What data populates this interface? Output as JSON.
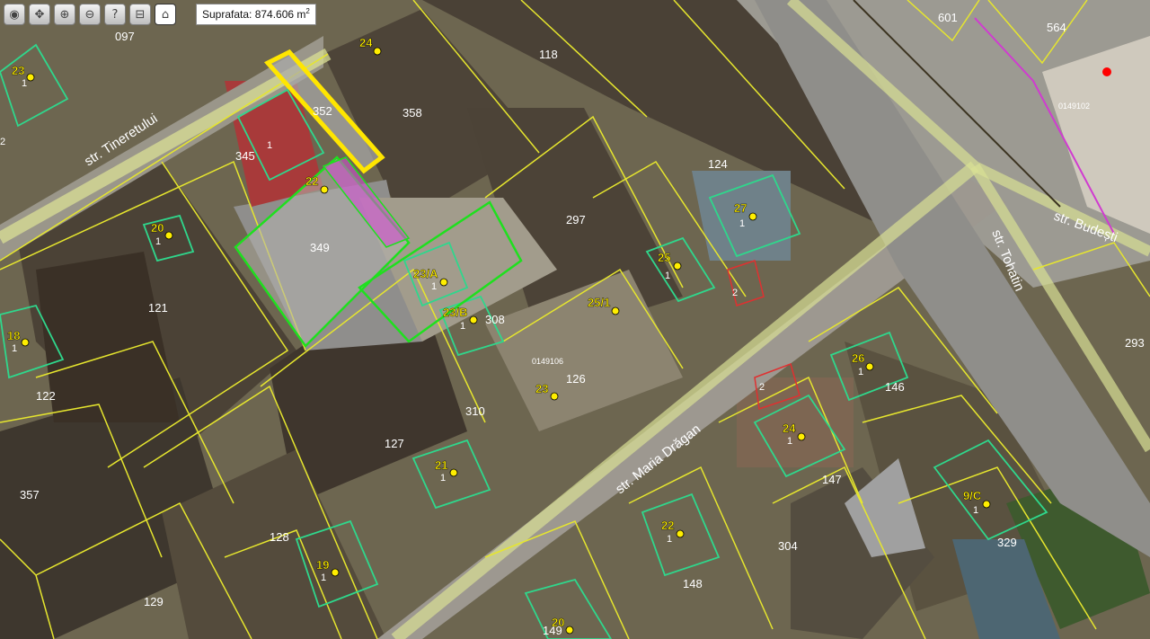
{
  "toolbar": {
    "buttons": [
      {
        "name": "zoom-extent-icon",
        "glyph": "◉"
      },
      {
        "name": "pan-icon",
        "glyph": "✥"
      },
      {
        "name": "zoom-in-icon",
        "glyph": "⊕"
      },
      {
        "name": "zoom-out-icon",
        "glyph": "⊖"
      },
      {
        "name": "info-icon",
        "glyph": "?"
      },
      {
        "name": "measure-distance-icon",
        "glyph": "⊟"
      },
      {
        "name": "measure-area-icon",
        "glyph": "⌂"
      }
    ]
  },
  "measurement": {
    "label": "Suprafata: 874.606 m",
    "unit_exp": "2"
  },
  "colors": {
    "parcel_border": "#e6e62e",
    "building_border": "#2fd78c",
    "selected_parcel": "#ffe600",
    "highlight_green": "#1ee01e",
    "highlight_magenta": "#d050d0",
    "road_overlay": "#d9df94",
    "point_marker": "#ffee00",
    "point_marker_red": "#ff0000",
    "label_text": "#ffffff",
    "house_label": "#ffee00"
  },
  "streets": [
    {
      "name": "str. Tineretului"
    },
    {
      "name": "str. Maria Drăgan"
    },
    {
      "name": "str. Tohatin"
    },
    {
      "name": "str. Budești"
    }
  ],
  "parcels": [
    "097",
    "118",
    "358",
    "352",
    "345",
    "349",
    "121",
    "122",
    "357",
    "127",
    "128",
    "129",
    "310",
    "308",
    "297",
    "124",
    "126",
    "146",
    "147",
    "148",
    "304",
    "329",
    "293",
    "601",
    "564",
    "149"
  ],
  "sector_codes": [
    "0149102",
    "0149106"
  ],
  "house_numbers": [
    "23",
    "24",
    "20",
    "22",
    "18",
    "23/A",
    "23/B",
    "25/1",
    "23",
    "21",
    "19",
    "25",
    "27",
    "26",
    "24",
    "22",
    "9/C",
    "20"
  ],
  "building_ids": [
    "1",
    "2"
  ]
}
